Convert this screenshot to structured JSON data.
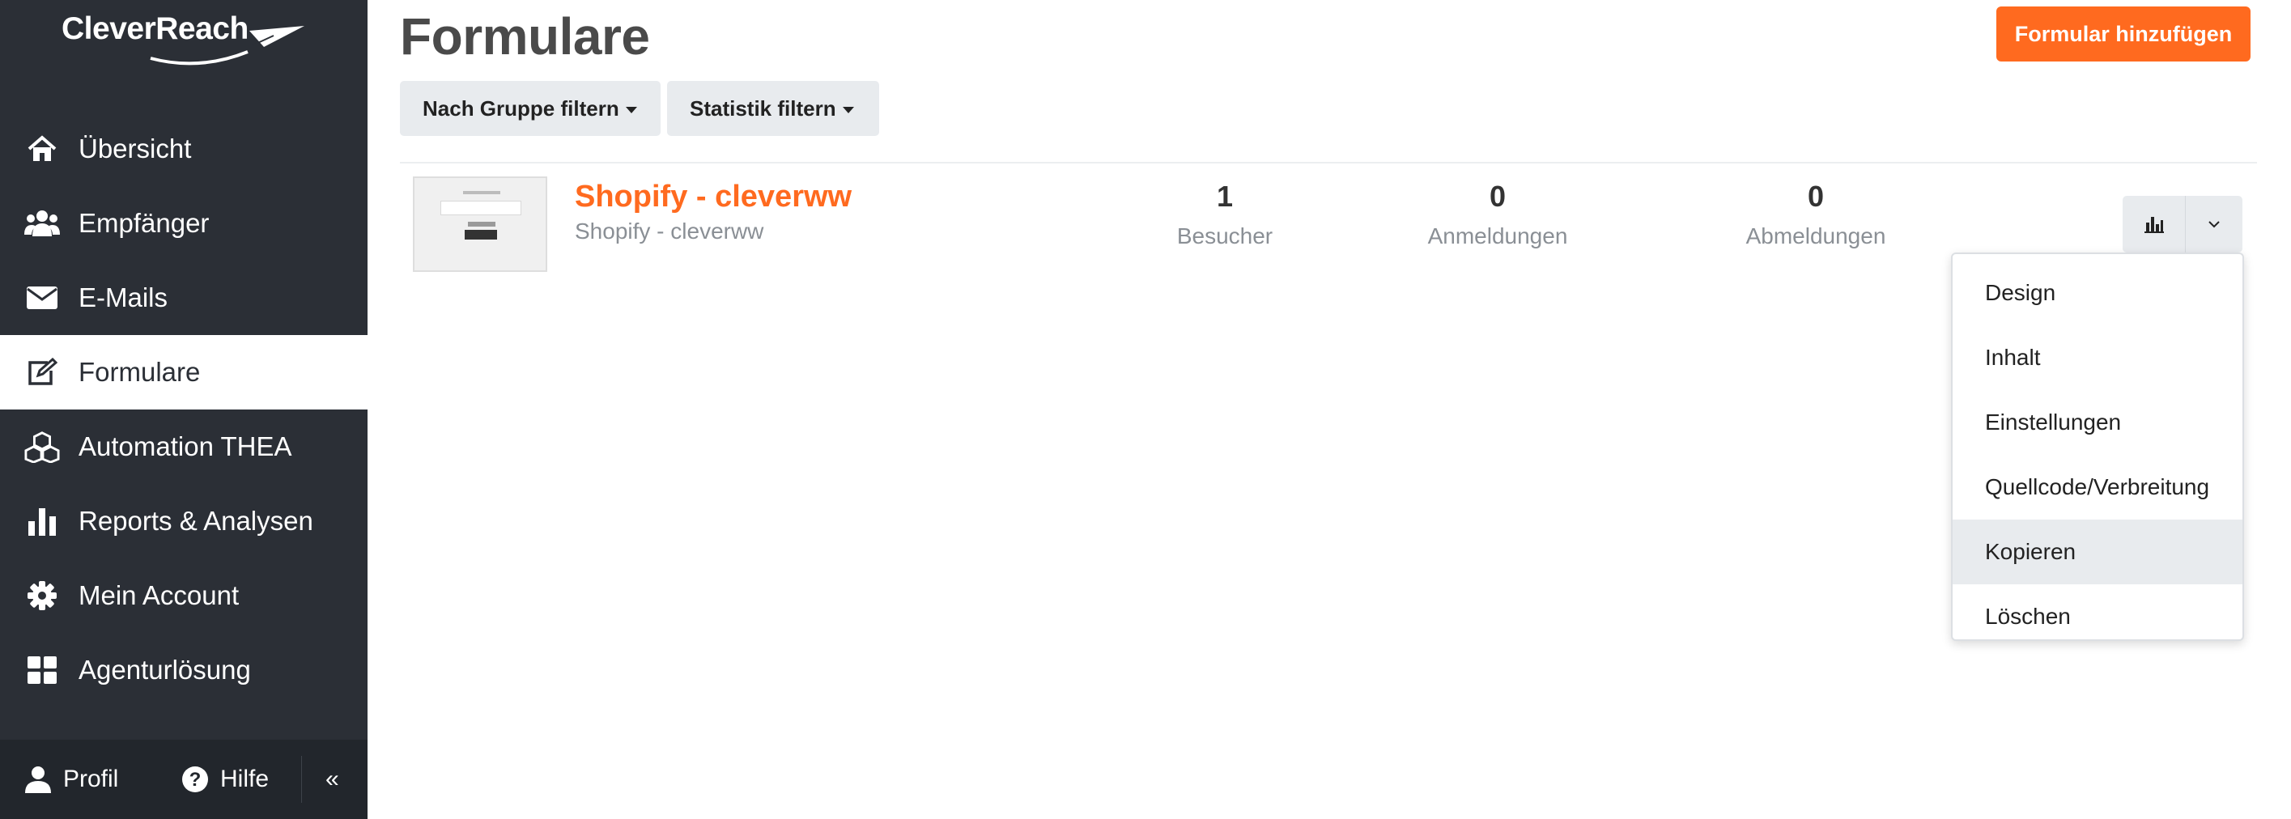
{
  "app": {
    "logo_text": "CleverReach"
  },
  "sidebar": {
    "items": [
      {
        "label": "Übersicht",
        "icon": "home-icon"
      },
      {
        "label": "Empfänger",
        "icon": "users-icon"
      },
      {
        "label": "E-Mails",
        "icon": "envelope-icon"
      },
      {
        "label": "Formulare",
        "icon": "edit-form-icon",
        "active": true
      },
      {
        "label": "Automation THEA",
        "icon": "cubes-icon"
      },
      {
        "label": "Reports & Analysen",
        "icon": "bar-chart-icon"
      },
      {
        "label": "Mein Account",
        "icon": "gear-icon"
      },
      {
        "label": "Agenturlösung",
        "icon": "grid-icon"
      }
    ],
    "footer": {
      "profile_label": "Profil",
      "help_label": "Hilfe",
      "collapse_glyph": "«"
    }
  },
  "header": {
    "title": "Formulare",
    "add_button": "Formular hinzufügen"
  },
  "filters": {
    "group_label": "Nach Gruppe filtern",
    "stats_label": "Statistik filtern"
  },
  "form_row": {
    "name": "Shopify - cleverww",
    "subtitle": "Shopify - cleverww",
    "stats": [
      {
        "value": "1",
        "label": "Besucher"
      },
      {
        "value": "0",
        "label": "Anmeldungen"
      },
      {
        "value": "0",
        "label": "Abmeldungen"
      }
    ]
  },
  "dropdown": {
    "items": [
      "Design",
      "Inhalt",
      "Einstellungen",
      "Quellcode/Verbreitung",
      "Kopieren",
      "Löschen"
    ],
    "highlighted": "Kopieren"
  },
  "colors": {
    "sidebar_bg": "#2b2f36",
    "accent": "#ff6a1f",
    "button_grey": "#e8ebee"
  }
}
